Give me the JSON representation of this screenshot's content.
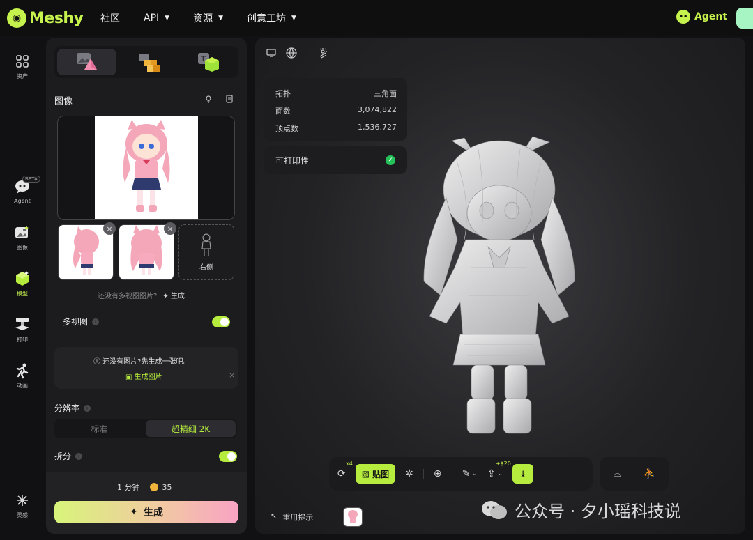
{
  "brand": {
    "name": "Meshy"
  },
  "nav": {
    "items": [
      "社区",
      "API",
      "资源",
      "创意工坊"
    ],
    "agent_label": "Agent"
  },
  "rail": {
    "items": [
      {
        "label": "资产",
        "icon": "grid-icon"
      },
      {
        "label": "Agent",
        "icon": "agent-icon",
        "badge": "BETA"
      },
      {
        "label": "图像",
        "icon": "image-icon"
      },
      {
        "label": "模型",
        "icon": "model-cube-icon"
      },
      {
        "label": "打印",
        "icon": "printer-icon"
      },
      {
        "label": "动画",
        "icon": "running-icon"
      },
      {
        "label": "灵感",
        "icon": "sparkle-icon"
      }
    ]
  },
  "panel": {
    "image_section_title": "图像",
    "right_side_label": "右侧",
    "no_multiview_hint": "还没有多视图图片?",
    "generate_small": "生成",
    "multiview_label": "多视图",
    "no_image_question": "还没有图片?先生成一张吧。",
    "generate_image": "生成图片",
    "resolution_label": "分辨率",
    "resolution_options": [
      "标准",
      "超精细 2K"
    ],
    "resolution_selected": "超精细 2K",
    "split_label": "拆分",
    "time_estimate": "1 分钟",
    "credits": "35",
    "generate_button": "生成"
  },
  "viewer": {
    "stats": [
      {
        "label": "拓扑",
        "value": "三角面"
      },
      {
        "label": "面数",
        "value": "3,074,822"
      },
      {
        "label": "顶点数",
        "value": "1,536,727"
      }
    ],
    "printability_label": "可打印性",
    "toolbar": {
      "remesh_badge": "x4",
      "texture_label": "贴图",
      "export_price": "+$20"
    },
    "reuse_prompt": "重用提示"
  },
  "watermark": "公众号 · 夕小瑶科技说",
  "colors": {
    "accent": "#b6ec3e",
    "brand": "#c6f24e",
    "check": "#25c25a"
  }
}
